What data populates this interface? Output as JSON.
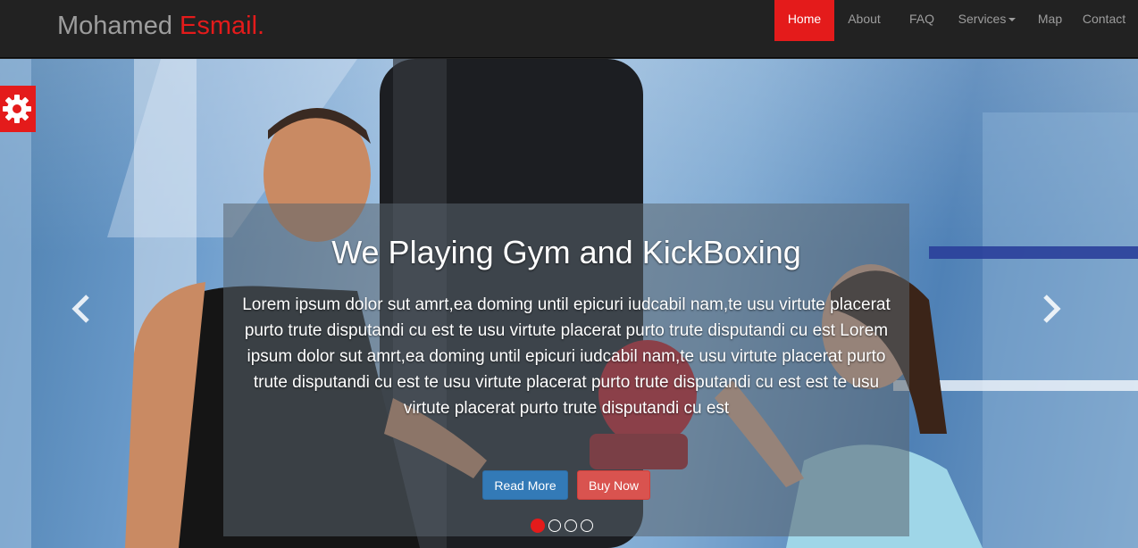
{
  "brand": {
    "name": "Mohamed",
    "accent": "Esmail."
  },
  "nav": {
    "home": "Home",
    "about": "About",
    "faq": "FAQ",
    "services": "Services",
    "map": "Map",
    "contact": "Contact",
    "active": "Home"
  },
  "hero": {
    "title": "We Playing Gym and KickBoxing",
    "text": "Lorem ipsum dolor sut amrt,ea doming until epicuri iudcabil nam,te usu virtute placerat purto trute disputandi cu est te usu virtute placerat purto trute disputandi cu est Lorem ipsum dolor sut amrt,ea doming until epicuri iudcabil nam,te usu virtute placerat purto trute disputandi cu est te usu virtute placerat purto trute disputandi cu est est te usu virtute placerat purto trute disputandi cu est",
    "read_more": "Read More",
    "buy_now": "Buy Now"
  },
  "carousel": {
    "slides": 4,
    "active_index": 0
  },
  "colors": {
    "accent": "#e41b1b",
    "navbar": "#222222",
    "primary_btn": "#337ab7",
    "danger_btn": "#d9534f"
  },
  "icons": {
    "settings": "gear-icon",
    "prev": "chevron-left-icon",
    "next": "chevron-right-icon",
    "dropdown": "caret-down-icon"
  }
}
